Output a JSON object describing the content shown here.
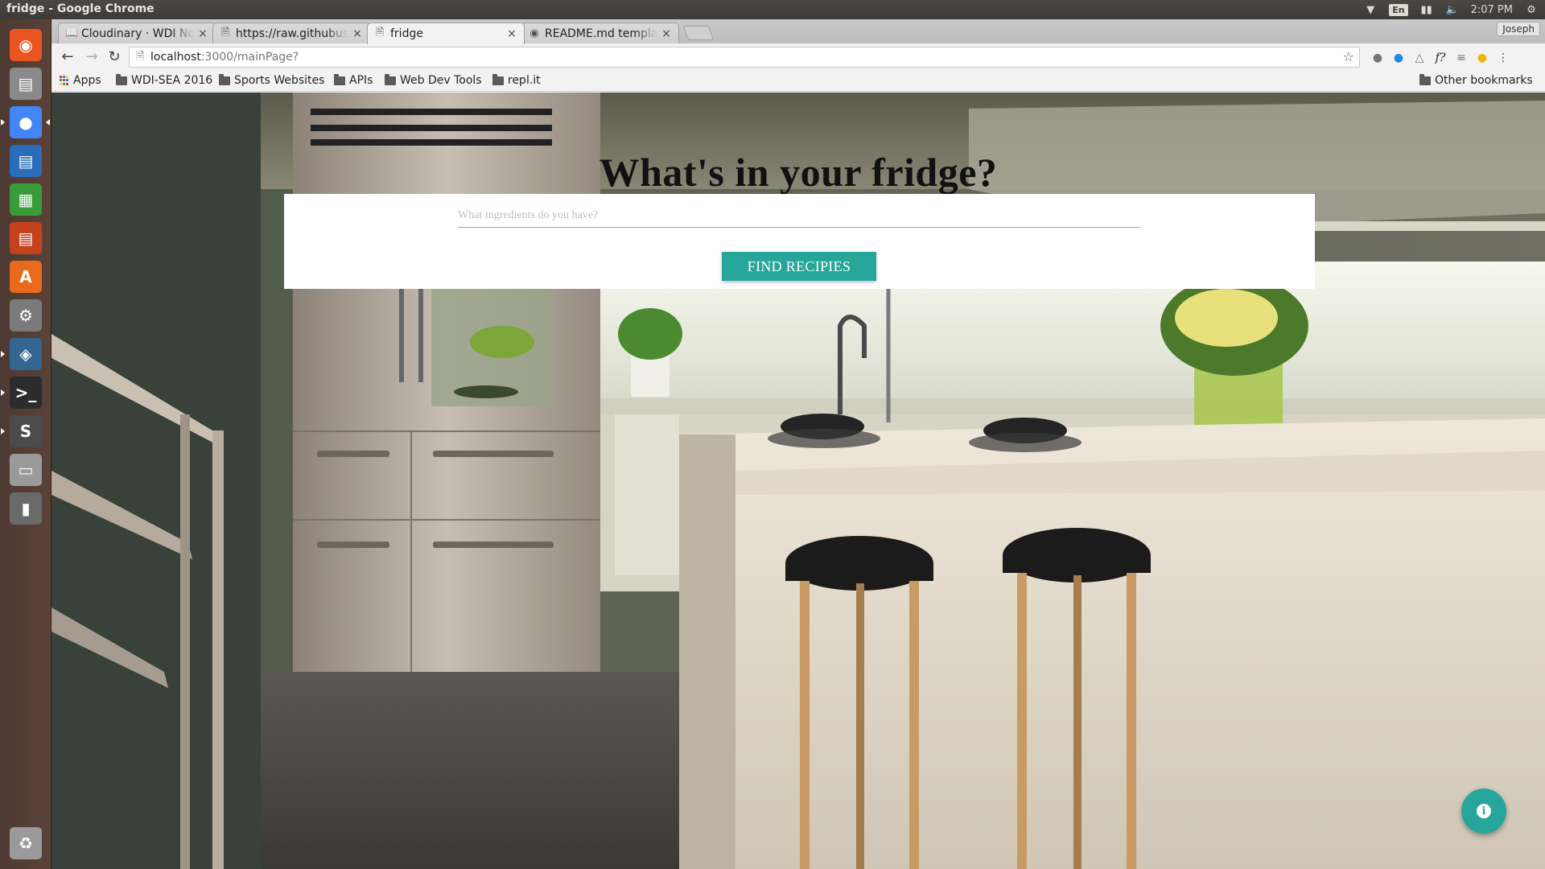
{
  "system_bar": {
    "window_title": "fridge - Google Chrome",
    "language": "En",
    "clock": "2:07 PM"
  },
  "launcher": {
    "items": [
      {
        "name": "ubuntu-dash-icon",
        "color": "#e95420"
      },
      {
        "name": "files-icon",
        "color": "#8a8a8a"
      },
      {
        "name": "chrome-icon",
        "color": "#4285f4"
      },
      {
        "name": "writer-icon",
        "color": "#2a6ebb"
      },
      {
        "name": "calc-icon",
        "color": "#3a9b3a"
      },
      {
        "name": "impress-icon",
        "color": "#c4431c"
      },
      {
        "name": "software-center-icon",
        "color": "#e96a1c"
      },
      {
        "name": "system-settings-icon",
        "color": "#7a7a7a"
      },
      {
        "name": "postgresql-icon",
        "color": "#336791"
      },
      {
        "name": "terminal-icon",
        "color": "#2c2c2c"
      },
      {
        "name": "sublime-text-icon",
        "color": "#4b4b4b"
      },
      {
        "name": "drive-icon",
        "color": "#9a9a9a"
      },
      {
        "name": "device-icon",
        "color": "#6a6a6a"
      },
      {
        "name": "trash-icon",
        "color": "#9a9a9a"
      }
    ]
  },
  "tabs": [
    {
      "label": "Cloudinary · WDI Notes",
      "icon": "book-icon",
      "active": false
    },
    {
      "label": "https://raw.githubusercontent",
      "icon": "page-icon",
      "active": false
    },
    {
      "label": "fridge",
      "icon": "page-icon",
      "active": true
    },
    {
      "label": "README.md template",
      "icon": "github-icon",
      "active": false
    }
  ],
  "profile_name": "Joseph",
  "toolbar": {
    "url_host": "localhost",
    "url_path": ":3000/mainPage?"
  },
  "bookmarks": {
    "apps": "Apps",
    "items": [
      "WDI-SEA 2016",
      "Sports Websites",
      "APIs",
      "Web Dev Tools",
      "repl.it"
    ],
    "other": "Other bookmarks"
  },
  "page": {
    "title": "What's in your fridge?",
    "search_placeholder": "What ingredients do you have?",
    "search_value": "",
    "button_label": "FIND RECIPIES",
    "accent_color": "#26a69a"
  }
}
